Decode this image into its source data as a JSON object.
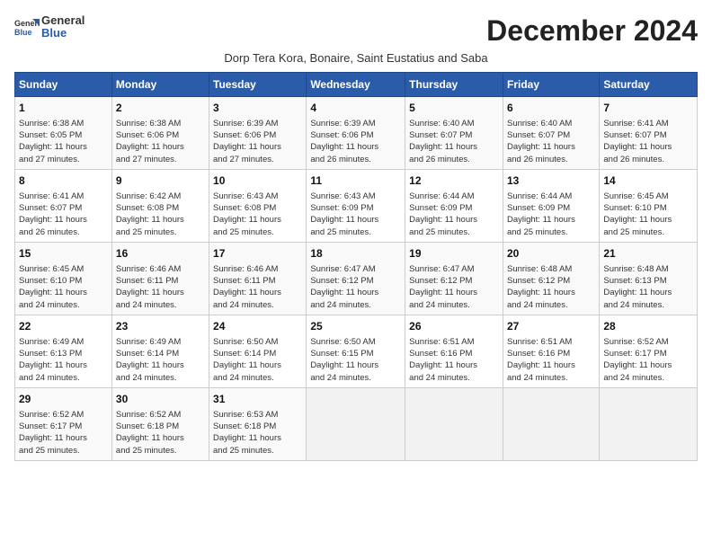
{
  "header": {
    "logo_general": "General",
    "logo_blue": "Blue",
    "month_title": "December 2024",
    "subtitle": "Dorp Tera Kora, Bonaire, Saint Eustatius and Saba"
  },
  "days_of_week": [
    "Sunday",
    "Monday",
    "Tuesday",
    "Wednesday",
    "Thursday",
    "Friday",
    "Saturday"
  ],
  "weeks": [
    [
      {
        "day": "1",
        "lines": [
          "Sunrise: 6:38 AM",
          "Sunset: 6:05 PM",
          "Daylight: 11 hours",
          "and 27 minutes."
        ]
      },
      {
        "day": "2",
        "lines": [
          "Sunrise: 6:38 AM",
          "Sunset: 6:06 PM",
          "Daylight: 11 hours",
          "and 27 minutes."
        ]
      },
      {
        "day": "3",
        "lines": [
          "Sunrise: 6:39 AM",
          "Sunset: 6:06 PM",
          "Daylight: 11 hours",
          "and 27 minutes."
        ]
      },
      {
        "day": "4",
        "lines": [
          "Sunrise: 6:39 AM",
          "Sunset: 6:06 PM",
          "Daylight: 11 hours",
          "and 26 minutes."
        ]
      },
      {
        "day": "5",
        "lines": [
          "Sunrise: 6:40 AM",
          "Sunset: 6:07 PM",
          "Daylight: 11 hours",
          "and 26 minutes."
        ]
      },
      {
        "day": "6",
        "lines": [
          "Sunrise: 6:40 AM",
          "Sunset: 6:07 PM",
          "Daylight: 11 hours",
          "and 26 minutes."
        ]
      },
      {
        "day": "7",
        "lines": [
          "Sunrise: 6:41 AM",
          "Sunset: 6:07 PM",
          "Daylight: 11 hours",
          "and 26 minutes."
        ]
      }
    ],
    [
      {
        "day": "8",
        "lines": [
          "Sunrise: 6:41 AM",
          "Sunset: 6:07 PM",
          "Daylight: 11 hours",
          "and 26 minutes."
        ]
      },
      {
        "day": "9",
        "lines": [
          "Sunrise: 6:42 AM",
          "Sunset: 6:08 PM",
          "Daylight: 11 hours",
          "and 25 minutes."
        ]
      },
      {
        "day": "10",
        "lines": [
          "Sunrise: 6:43 AM",
          "Sunset: 6:08 PM",
          "Daylight: 11 hours",
          "and 25 minutes."
        ]
      },
      {
        "day": "11",
        "lines": [
          "Sunrise: 6:43 AM",
          "Sunset: 6:09 PM",
          "Daylight: 11 hours",
          "and 25 minutes."
        ]
      },
      {
        "day": "12",
        "lines": [
          "Sunrise: 6:44 AM",
          "Sunset: 6:09 PM",
          "Daylight: 11 hours",
          "and 25 minutes."
        ]
      },
      {
        "day": "13",
        "lines": [
          "Sunrise: 6:44 AM",
          "Sunset: 6:09 PM",
          "Daylight: 11 hours",
          "and 25 minutes."
        ]
      },
      {
        "day": "14",
        "lines": [
          "Sunrise: 6:45 AM",
          "Sunset: 6:10 PM",
          "Daylight: 11 hours",
          "and 25 minutes."
        ]
      }
    ],
    [
      {
        "day": "15",
        "lines": [
          "Sunrise: 6:45 AM",
          "Sunset: 6:10 PM",
          "Daylight: 11 hours",
          "and 24 minutes."
        ]
      },
      {
        "day": "16",
        "lines": [
          "Sunrise: 6:46 AM",
          "Sunset: 6:11 PM",
          "Daylight: 11 hours",
          "and 24 minutes."
        ]
      },
      {
        "day": "17",
        "lines": [
          "Sunrise: 6:46 AM",
          "Sunset: 6:11 PM",
          "Daylight: 11 hours",
          "and 24 minutes."
        ]
      },
      {
        "day": "18",
        "lines": [
          "Sunrise: 6:47 AM",
          "Sunset: 6:12 PM",
          "Daylight: 11 hours",
          "and 24 minutes."
        ]
      },
      {
        "day": "19",
        "lines": [
          "Sunrise: 6:47 AM",
          "Sunset: 6:12 PM",
          "Daylight: 11 hours",
          "and 24 minutes."
        ]
      },
      {
        "day": "20",
        "lines": [
          "Sunrise: 6:48 AM",
          "Sunset: 6:12 PM",
          "Daylight: 11 hours",
          "and 24 minutes."
        ]
      },
      {
        "day": "21",
        "lines": [
          "Sunrise: 6:48 AM",
          "Sunset: 6:13 PM",
          "Daylight: 11 hours",
          "and 24 minutes."
        ]
      }
    ],
    [
      {
        "day": "22",
        "lines": [
          "Sunrise: 6:49 AM",
          "Sunset: 6:13 PM",
          "Daylight: 11 hours",
          "and 24 minutes."
        ]
      },
      {
        "day": "23",
        "lines": [
          "Sunrise: 6:49 AM",
          "Sunset: 6:14 PM",
          "Daylight: 11 hours",
          "and 24 minutes."
        ]
      },
      {
        "day": "24",
        "lines": [
          "Sunrise: 6:50 AM",
          "Sunset: 6:14 PM",
          "Daylight: 11 hours",
          "and 24 minutes."
        ]
      },
      {
        "day": "25",
        "lines": [
          "Sunrise: 6:50 AM",
          "Sunset: 6:15 PM",
          "Daylight: 11 hours",
          "and 24 minutes."
        ]
      },
      {
        "day": "26",
        "lines": [
          "Sunrise: 6:51 AM",
          "Sunset: 6:16 PM",
          "Daylight: 11 hours",
          "and 24 minutes."
        ]
      },
      {
        "day": "27",
        "lines": [
          "Sunrise: 6:51 AM",
          "Sunset: 6:16 PM",
          "Daylight: 11 hours",
          "and 24 minutes."
        ]
      },
      {
        "day": "28",
        "lines": [
          "Sunrise: 6:52 AM",
          "Sunset: 6:17 PM",
          "Daylight: 11 hours",
          "and 24 minutes."
        ]
      }
    ],
    [
      {
        "day": "29",
        "lines": [
          "Sunrise: 6:52 AM",
          "Sunset: 6:17 PM",
          "Daylight: 11 hours",
          "and 25 minutes."
        ]
      },
      {
        "day": "30",
        "lines": [
          "Sunrise: 6:52 AM",
          "Sunset: 6:18 PM",
          "Daylight: 11 hours",
          "and 25 minutes."
        ]
      },
      {
        "day": "31",
        "lines": [
          "Sunrise: 6:53 AM",
          "Sunset: 6:18 PM",
          "Daylight: 11 hours",
          "and 25 minutes."
        ]
      },
      null,
      null,
      null,
      null
    ]
  ]
}
